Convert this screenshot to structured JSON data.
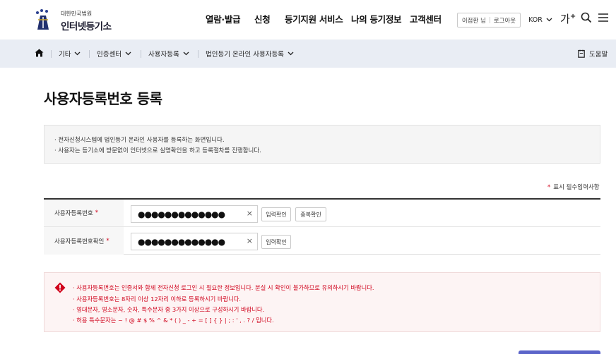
{
  "header": {
    "logo_small": "대한민국법원",
    "logo_big": "인터넷등기소",
    "nav": [
      "열람·발급",
      "신청",
      "등기지원 서비스",
      "나의 등기정보",
      "고객센터"
    ],
    "user_name": "이점환 님",
    "logout_label": "로그아웃",
    "language": "KOR",
    "font_size_label": "가",
    "font_size_plus": "+"
  },
  "breadcrumb": {
    "items": [
      "기타",
      "인증센터",
      "사용자등록",
      "법인등기 온라인 사용자등록"
    ],
    "help_label": "도움말"
  },
  "page": {
    "title": "사용자등록번호 등록",
    "info_lines": [
      "· 전자신청시스템에 법인등기 온라인 사용자를 등록하는 화면입니다.",
      "· 사용자는 등기소에 방문없이 인터넷으로 실명확인을 하고 등록절차를 진행합니다."
    ],
    "required_note": "표시 필수입력사항",
    "required_star": "*"
  },
  "form": {
    "row1": {
      "label": "사용자등록번호",
      "value_masked": "●●●●●●●●●●●●●",
      "clear_label": "×",
      "btn_check": "입력확인",
      "btn_dup": "중복확인"
    },
    "row2": {
      "label": "사용자등록번호확인",
      "value_masked": "●●●●●●●●●●●●●",
      "clear_label": "×",
      "btn_check": "입력확인"
    }
  },
  "warning": {
    "lines": [
      "· 사용자등록번호는 인증서와 함께 전자신청 로그인 시 필요한 정보입니다. 분실 시 확인이 불가하므로 유의하시기 바랍니다.",
      "· 사용자등록번호는 8자리 이상 12자리 이하로 등록하시기 바랍니다.",
      "· 영대문자, 영소문자, 숫자, 특수문자 중 3가지 이상으로 구성하시기 바랍니다.",
      "· 허용 특수문자는 ~ ! @ # $ % ^ & * ( ) _ - + = [ ] { } | ; : ' , . ? / 입니다."
    ]
  },
  "icons": {
    "home": "home-icon",
    "chevron": "chevron-down-icon",
    "search": "search-icon",
    "menu": "menu-icon",
    "help": "help-doc-icon",
    "warning": "warning-icon"
  },
  "colors": {
    "accent_red": "#d0021b",
    "crumb_bg": "#e9edf4",
    "button_blue": "#5b64c9"
  }
}
